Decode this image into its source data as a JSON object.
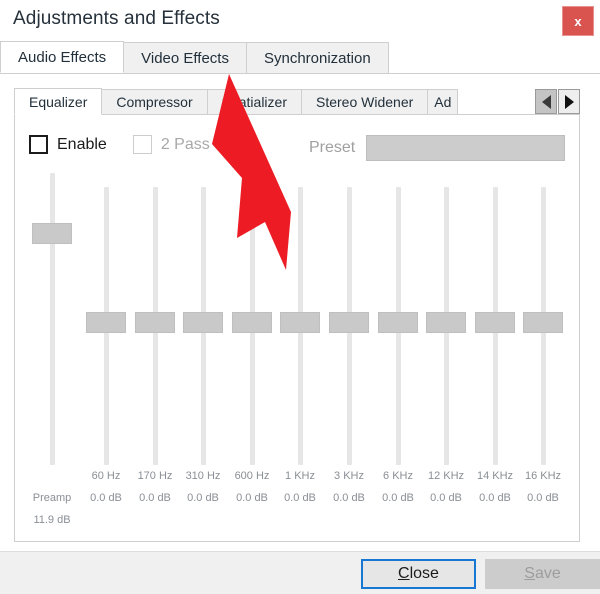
{
  "window": {
    "title": "Adjustments and Effects",
    "close_icon": "close-x-icon",
    "close_label": "x",
    "close_color": "#d9534f"
  },
  "outer_tabs": [
    {
      "label": "Audio Effects",
      "active": true
    },
    {
      "label": "Video Effects",
      "active": false
    },
    {
      "label": "Synchronization",
      "active": false
    }
  ],
  "inner_tabs": [
    {
      "label": "Equalizer",
      "active": true
    },
    {
      "label": "Compressor",
      "active": false
    },
    {
      "label": "Spatializer",
      "active": false
    },
    {
      "label": "Stereo Widener",
      "active": false
    },
    {
      "label": "Ad",
      "active": false
    }
  ],
  "tab_scroll": {
    "left_icon": "chevron-left-icon",
    "right_icon": "chevron-right-icon",
    "left_enabled": false,
    "right_enabled": true
  },
  "options": {
    "enable_label": "Enable",
    "enable_checked": false,
    "two_pass_label": "2 Pass",
    "two_pass_checked": false,
    "two_pass_enabled": false,
    "preset_label": "Preset",
    "preset_value": "",
    "preset_enabled": false,
    "preset_caret_icon": "chevron-down-icon"
  },
  "equalizer": {
    "preamp": {
      "name": "Preamp",
      "gain": "11.9 dB"
    },
    "bands": [
      {
        "freq": "60 Hz",
        "gain": "0.0 dB"
      },
      {
        "freq": "170 Hz",
        "gain": "0.0 dB"
      },
      {
        "freq": "310 Hz",
        "gain": "0.0 dB"
      },
      {
        "freq": "600 Hz",
        "gain": "0.0 dB"
      },
      {
        "freq": "1 KHz",
        "gain": "0.0 dB"
      },
      {
        "freq": "3 KHz",
        "gain": "0.0 dB"
      },
      {
        "freq": "6 KHz",
        "gain": "0.0 dB"
      },
      {
        "freq": "12 KHz",
        "gain": "0.0 dB"
      },
      {
        "freq": "14 KHz",
        "gain": "0.0 dB"
      },
      {
        "freq": "16 KHz",
        "gain": "0.0 dB"
      }
    ]
  },
  "footer": {
    "close_label_prefix": "",
    "close_accel": "C",
    "close_label_rest": "lose",
    "save_accel": "S",
    "save_label_rest": "ave",
    "save_enabled": false
  },
  "annotation": {
    "arrow_color": "#ed1c24",
    "points_to": "Video Effects"
  }
}
